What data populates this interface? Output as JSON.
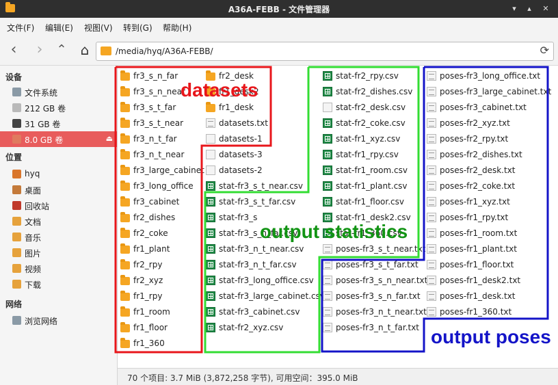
{
  "window": {
    "title": "A36A-FEBB - 文件管理器"
  },
  "menu": [
    "文件(F)",
    "编辑(E)",
    "视图(V)",
    "转到(G)",
    "帮助(H)"
  ],
  "toolbar": {
    "path": "/media/hyq/A36A-FEBB/"
  },
  "sidebar": {
    "devices_heading": "设备",
    "devices": [
      {
        "label": "文件系统",
        "icon": "harddisk-icon"
      },
      {
        "label": "212 GB 卷",
        "icon": "drive-icon"
      },
      {
        "label": "31 GB 卷",
        "icon": "sdcard-icon"
      },
      {
        "label": "8.0 GB 卷",
        "icon": "usb-drive-icon",
        "selected": true
      }
    ],
    "places_heading": "位置",
    "places": [
      {
        "label": "hyq",
        "icon": "home-icon"
      },
      {
        "label": "桌面",
        "icon": "desktop-icon"
      },
      {
        "label": "回收站",
        "icon": "trash-icon"
      },
      {
        "label": "文档",
        "icon": "documents-icon"
      },
      {
        "label": "音乐",
        "icon": "music-icon"
      },
      {
        "label": "图片",
        "icon": "pictures-icon"
      },
      {
        "label": "视频",
        "icon": "videos-icon"
      },
      {
        "label": "下载",
        "icon": "downloads-icon"
      }
    ],
    "network_heading": "网络",
    "network": [
      {
        "label": "浏览网络",
        "icon": "network-icon"
      }
    ]
  },
  "columns": [
    [
      {
        "name": "fr3_s_n_far",
        "type": "folder"
      },
      {
        "name": "fr3_s_n_near",
        "type": "folder"
      },
      {
        "name": "fr3_s_t_far",
        "type": "folder"
      },
      {
        "name": "fr3_s_t_near",
        "type": "folder"
      },
      {
        "name": "fr3_n_t_far",
        "type": "folder"
      },
      {
        "name": "fr3_n_t_near",
        "type": "folder"
      },
      {
        "name": "fr3_large_cabinet",
        "type": "folder"
      },
      {
        "name": "fr3_long_office",
        "type": "folder"
      },
      {
        "name": "fr3_cabinet",
        "type": "folder"
      },
      {
        "name": "fr2_dishes",
        "type": "folder"
      },
      {
        "name": "fr2_coke",
        "type": "folder"
      },
      {
        "name": "fr1_plant",
        "type": "folder"
      },
      {
        "name": "fr2_rpy",
        "type": "folder"
      },
      {
        "name": "fr2_xyz",
        "type": "folder"
      },
      {
        "name": "fr1_rpy",
        "type": "folder"
      },
      {
        "name": "fr1_room",
        "type": "folder"
      },
      {
        "name": "fr1_floor",
        "type": "folder"
      },
      {
        "name": "fr1_360",
        "type": "folder"
      }
    ],
    [
      {
        "name": "fr2_desk",
        "type": "folder"
      },
      {
        "name": "fr1_desk2",
        "type": "folder"
      },
      {
        "name": "fr1_desk",
        "type": "folder"
      },
      {
        "name": "datasets.txt",
        "type": "txt"
      },
      {
        "name": "datasets-1",
        "type": "file-generic"
      },
      {
        "name": "datasets-3",
        "type": "file-generic"
      },
      {
        "name": "datasets-2",
        "type": "file-generic"
      },
      {
        "name": "stat-fr3_s_t_near.csv",
        "type": "csv"
      },
      {
        "name": "stat-fr3_s_t_far.csv",
        "type": "csv"
      },
      {
        "name": "stat-fr3_s",
        "type": "csv"
      },
      {
        "name": "stat-fr3_s_n_far.csv",
        "type": "csv"
      },
      {
        "name": "stat-fr3_n_t_near.csv",
        "type": "csv"
      },
      {
        "name": "stat-fr3_n_t_far.csv",
        "type": "csv"
      },
      {
        "name": "stat-fr3_long_office.csv",
        "type": "csv"
      },
      {
        "name": "stat-fr3_large_cabinet.csv",
        "type": "csv"
      },
      {
        "name": "stat-fr3_cabinet.csv",
        "type": "csv"
      },
      {
        "name": "stat-fr2_xyz.csv",
        "type": "csv"
      }
    ],
    [
      {
        "name": "stat-fr2_rpy.csv",
        "type": "csv"
      },
      {
        "name": "stat-fr2_dishes.csv",
        "type": "csv"
      },
      {
        "name": "stat-fr2_desk.csv",
        "type": "file-generic"
      },
      {
        "name": "stat-fr2_coke.csv",
        "type": "csv"
      },
      {
        "name": "stat-fr1_xyz.csv",
        "type": "csv"
      },
      {
        "name": "stat-fr1_rpy.csv",
        "type": "csv"
      },
      {
        "name": "stat-fr1_room.csv",
        "type": "csv"
      },
      {
        "name": "stat-fr1_plant.csv",
        "type": "csv"
      },
      {
        "name": "stat-fr1_floor.csv",
        "type": "csv"
      },
      {
        "name": "stat-fr1_desk2.csv",
        "type": "csv"
      },
      {
        "name": "stat-fr1_360.csv",
        "type": "csv"
      },
      {
        "name": "poses-fr3_s_t_near.txt",
        "type": "txt"
      },
      {
        "name": "poses-fr3_s_t_far.txt",
        "type": "txt"
      },
      {
        "name": "poses-fr3_s_n_near.txt",
        "type": "txt"
      },
      {
        "name": "poses-fr3_s_n_far.txt",
        "type": "txt"
      },
      {
        "name": "poses-fr3_n_t_near.txt",
        "type": "txt"
      },
      {
        "name": "poses-fr3_n_t_far.txt",
        "type": "txt"
      }
    ],
    [
      {
        "name": "poses-fr3_long_office.txt",
        "type": "txt"
      },
      {
        "name": "poses-fr3_large_cabinet.txt",
        "type": "txt"
      },
      {
        "name": "poses-fr3_cabinet.txt",
        "type": "txt"
      },
      {
        "name": "poses-fr2_xyz.txt",
        "type": "txt"
      },
      {
        "name": "poses-fr2_rpy.txt",
        "type": "txt"
      },
      {
        "name": "poses-fr2_dishes.txt",
        "type": "txt"
      },
      {
        "name": "poses-fr2_desk.txt",
        "type": "txt"
      },
      {
        "name": "poses-fr2_coke.txt",
        "type": "txt"
      },
      {
        "name": "poses-fr1_xyz.txt",
        "type": "txt"
      },
      {
        "name": "poses-fr1_rpy.txt",
        "type": "txt"
      },
      {
        "name": "poses-fr1_room.txt",
        "type": "txt"
      },
      {
        "name": "poses-fr1_plant.txt",
        "type": "txt"
      },
      {
        "name": "poses-fr1_floor.txt",
        "type": "txt"
      },
      {
        "name": "poses-fr1_desk2.txt",
        "type": "txt"
      },
      {
        "name": "poses-fr1_desk.txt",
        "type": "txt"
      },
      {
        "name": "poses-fr1_360.txt",
        "type": "txt"
      }
    ]
  ],
  "annotations": {
    "datasets": {
      "text": "datasets",
      "color": "#e8161b"
    },
    "statistics": {
      "text": "output statistics",
      "color": "#129414"
    },
    "poses": {
      "text": "output poses",
      "color": "#1414c8"
    },
    "green_border": "#33dd33"
  },
  "status": "70 个项目: 3.7 MiB (3,872,258 字节), 可用空间：395.0 MiB"
}
